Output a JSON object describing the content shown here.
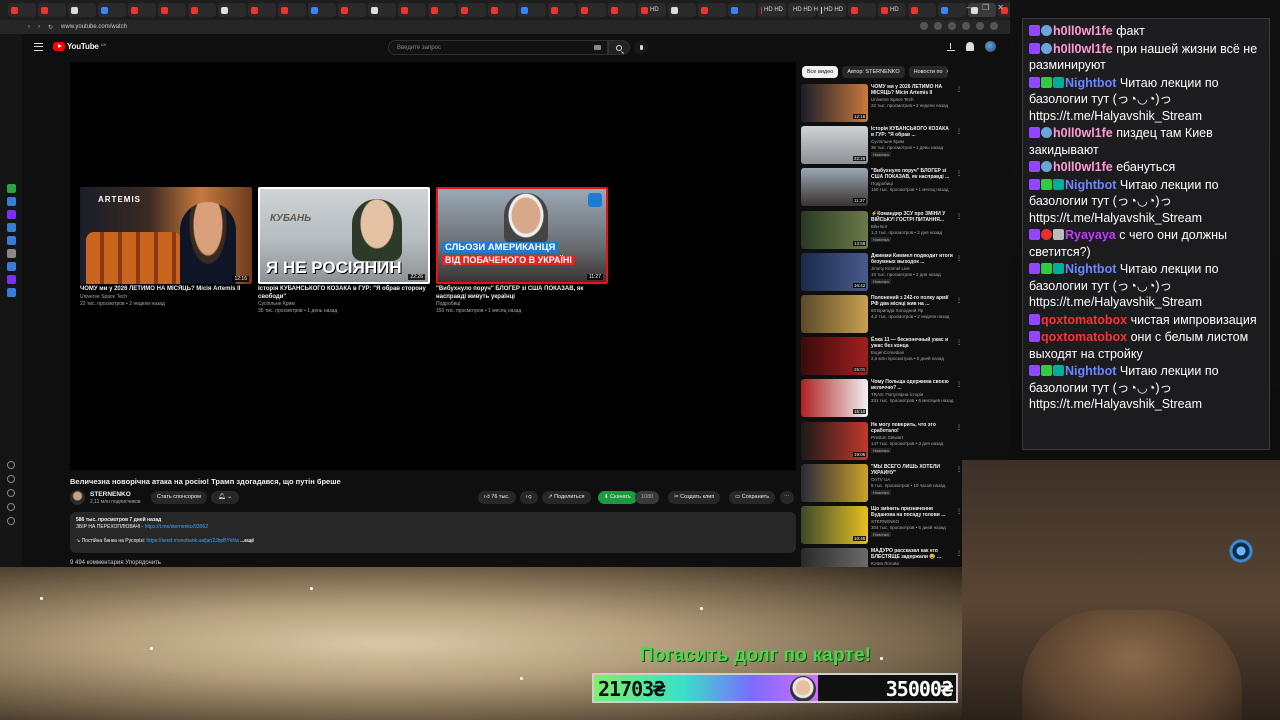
{
  "browser": {
    "tabs": [
      "",
      "",
      "",
      "",
      "",
      "",
      "",
      "",
      "",
      "",
      "",
      "",
      "",
      "",
      "",
      "",
      "",
      "",
      "",
      "",
      "",
      "HD",
      "",
      "",
      "",
      "HD HD",
      "HD HD HD",
      "HD HD",
      "",
      "HD",
      "",
      "",
      "",
      "",
      "",
      "",
      ""
    ],
    "url": "www.youtube.com/watch"
  },
  "youtube": {
    "logo_text": "YouTube",
    "logo_cc": "UA",
    "search_placeholder": "Введите запрос",
    "endcards": [
      {
        "title": "ЧОМУ ми у 2026 ЛЕТИМО НА МІСЯЦЬ? Місія Artemis II",
        "channel": "Universe Space Tech",
        "meta": "22 тис. просмотров • 2 недели назад",
        "duration": "12:16",
        "thumb_text": "ARTEMIS"
      },
      {
        "title": "Історія КУБАНСЬКОГО КОЗАКА в ГУР: \"Я обрав сторону свободи\"",
        "channel": "Суспільне Крим",
        "meta": "35 тис. просмотров • 1 день назад",
        "duration": "22:26",
        "thumb_text_1": "КУБАНЬ",
        "thumb_text_2": "Я НЕ РОСІЯНИН"
      },
      {
        "title": "\"Вибухнуло поруч\" БЛОГЕР зі США ПОКАЗАВ, як насправді живуть українці",
        "channel": "Подробиці",
        "meta": "150 тис. просмотров • 1 месяц назад",
        "duration": "11:27",
        "thumb_text_1": "СЛЬОЗИ АМЕРИКАНЦЯ",
        "thumb_text_2": "ВІД ПОБАЧЕНОГО В УКРАЇНІ"
      }
    ],
    "video_title": "Величезна новорічна атака на росію! Трамп здогадався, що путін бреше",
    "channel_name": "STERNENKO",
    "channel_subs": "2,11 млн подписчиков",
    "sponsor_label": "Стать спонсором",
    "likes": "76 тыс.",
    "share_label": "Поделиться",
    "thanks_label": "Скачать",
    "thanks_count": "1080",
    "clip_label": "Создать клип",
    "save_label": "Сохранить",
    "desc_views": "586 тыс. просмотров  7 дней назад",
    "desc_line1_label": "ЗБІР НА ПЕРЕХОПЛЮВАЧІ - ",
    "desc_line1_link": "https://t.me/sternenko/93062",
    "desc_line2_label": "↘ Постійна банка на Русорізі: ",
    "desc_line2_link": "https://send.monobank.ua/jar/2JbpBYkNa",
    "desc_more": "...ещё",
    "comments_peek": "9 494 комментария    Упорядочить",
    "chips": [
      "Все видео",
      "Автор: STERNENKO",
      "Новости по"
    ],
    "recommendations": [
      {
        "title": "ЧОМУ ми у 2026 ЛЕТИМО НА МІСЯЦЬ? Місія Artemis II",
        "channel": "Universe Space Tech",
        "meta": "22 тыс. просмотров • 2 недели назад",
        "badge": "",
        "duration": "12:16"
      },
      {
        "title": "Історія КУБАНСЬКОГО КОЗАКА в ГУР: \"Я обрав ...",
        "channel": "Суспільне Крим",
        "meta": "35 тыс. просмотров • 1 день назад",
        "badge": "Новинка",
        "duration": "22:26"
      },
      {
        "title": "\"Вибухнуло поруч\" БЛОГЕР зі США ПОКАЗАВ, як насправді ...",
        "channel": "Подробиці",
        "meta": "150 тыс. просмотров • 1 месяц назад",
        "badge": "",
        "duration": "11:27"
      },
      {
        "title": "⚡Командир ЗСУ про ЗМІНИ У ВІЙСЬКУ! ГОСТРІ ПИТАННЯ...",
        "channel": "Вйн Бот",
        "meta": "1,3 тыс. просмотров • 2 дня назад",
        "badge": "Новинка",
        "duration": "13:58"
      },
      {
        "title": "Джимми Киммел подводит итоги безумных выходок ...",
        "channel": "Jimmy Kimmel Live",
        "meta": "10 тыс. просмотров • 2 дня назад",
        "badge": "Новинка",
        "duration": "16:42"
      },
      {
        "title": "Полонений з 242-го полку армії РФ два місяці жив на ...",
        "channel": "93 Бригада Холодний Яр",
        "meta": "4,2 тыс. просмотров • 2 недели назад",
        "badge": "",
        "duration": ""
      },
      {
        "title": "Ёлка 11 — бесконечный ужас и ужас без конца",
        "channel": "EvgenComedian",
        "meta": "2,6 млн просмотров • 8 дней назад",
        "badge": "",
        "duration": "25:01"
      },
      {
        "title": "Чому Польща одержима своєю величчю? ...",
        "channel": "TRAS: Популярна історія",
        "meta": "331 тыс. просмотров • 6 месяцев назад",
        "badge": "",
        "duration": "15:10"
      },
      {
        "title": "Не могу поверить, что это сработало!",
        "channel": "Preston Stewart",
        "meta": "147 тыс. просмотров • 3 дня назад",
        "badge": "Новинка",
        "duration": "19:06"
      },
      {
        "title": "\"МЫ ВСЕГО ЛИШЬ ХОТЕЛИ УКРАИНУ\"",
        "channel": "OnTV UA",
        "meta": "8 тыс. просмотров • 10 часов назад",
        "badge": "Новинка",
        "duration": ""
      },
      {
        "title": "Що змінить призначення Буданова на посаду голови ...",
        "channel": "STERNENKO",
        "meta": "304 тыс. просмотров • 6 дней назад",
        "badge": "Новинка",
        "duration": "10:45"
      },
      {
        "title": "МАДУРО рассказал как его БЛЕСТЯЩЕ задержали 😂 ...",
        "channel": "Юлия Лотова",
        "meta": "",
        "badge": "",
        "duration": ""
      }
    ]
  },
  "chat": {
    "messages": [
      {
        "user": "h0ll0wl1fe",
        "text": "факт",
        "color": "pink",
        "badges": [
          "tw",
          "gl"
        ]
      },
      {
        "user": "h0ll0wl1fe",
        "text": "при нашей жизни всё не разминируют",
        "color": "pink",
        "badges": [
          "tw",
          "gl"
        ]
      },
      {
        "user": "Nightbot",
        "text": "Читаю лекции по базологии тут (っ◔◡◔)っ https://t.me/Halyavshik_Stream",
        "color": "blue",
        "badges": [
          "tw",
          "ck",
          "bt"
        ]
      },
      {
        "user": "h0ll0wl1fe",
        "text": "пиздец там Киев закидывают",
        "color": "pink",
        "badges": [
          "tw",
          "gl"
        ]
      },
      {
        "user": "h0ll0wl1fe",
        "text": "ебануться",
        "color": "pink",
        "badges": [
          "tw",
          "gl"
        ]
      },
      {
        "user": "Nightbot",
        "text": "Читаю лекции по базологии тут (っ◔◡◔)っ https://t.me/Halyavshik_Stream",
        "color": "blue",
        "badges": [
          "tw",
          "ck",
          "bt"
        ]
      },
      {
        "user": "Ryayaya",
        "text": "с чего они должны светится?)",
        "color": "mag",
        "badges": [
          "tw",
          "rd",
          "vol"
        ]
      },
      {
        "user": "Nightbot",
        "text": "Читаю лекции по базологии тут (っ◔◡◔)っ https://t.me/Halyavshik_Stream",
        "color": "blue",
        "badges": [
          "tw",
          "ck",
          "bt"
        ]
      },
      {
        "user": "qoxtomatobox",
        "text": "чистая импровизация",
        "color": "red",
        "badges": [
          "tw"
        ]
      },
      {
        "user": "qoxtomatobox",
        "text": "они с белым листом выходят на стройку",
        "color": "red",
        "badges": [
          "tw"
        ]
      },
      {
        "user": "Nightbot",
        "text": "Читаю лекции по базологии тут (っ◔◡◔)っ https://t.me/Halyavshik_Stream",
        "color": "blue",
        "badges": [
          "tw",
          "ck",
          "bt"
        ]
      }
    ]
  },
  "goal": {
    "title": "Погасить долг по карте!",
    "current": "21703₴",
    "target": "35000₴",
    "progress": 0.62
  },
  "colors": {
    "goal_green": "#4bd64b",
    "yt_red": "#ff0000",
    "nightbot": "#6b87ff",
    "pink_user": "#ff9bd3"
  }
}
